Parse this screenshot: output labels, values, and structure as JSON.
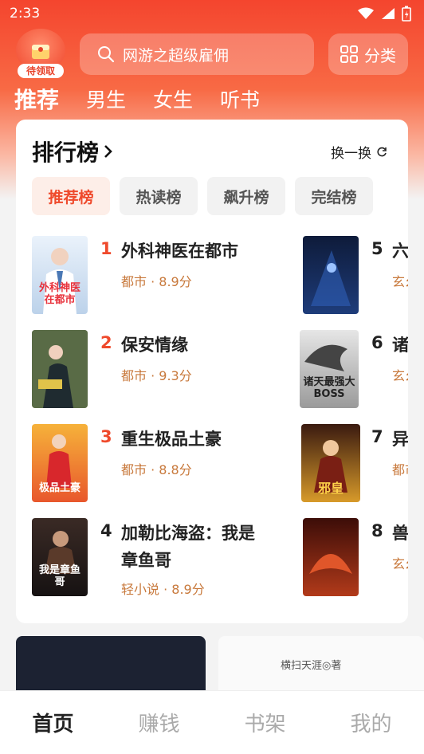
{
  "status_bar": {
    "time": "2:33"
  },
  "header": {
    "gift_badge": "待领取",
    "search_placeholder": "网游之超级雇佣",
    "category_label": "分类"
  },
  "tabs": [
    "推荐",
    "男生",
    "女生",
    "听书"
  ],
  "ranking": {
    "title": "排行榜",
    "refresh_label": "换一换",
    "rank_tabs": [
      "推荐榜",
      "热读榜",
      "飙升榜",
      "完结榜"
    ],
    "books": [
      {
        "rank": "1",
        "title": "外科神医在都市",
        "meta": "都市 · 8.9分",
        "cover_text": "外科神医在都市"
      },
      {
        "rank": "2",
        "title": "保安情缘",
        "meta": "都市 · 9.3分",
        "cover_text": ""
      },
      {
        "rank": "3",
        "title": "重生极品土豪",
        "meta": "都市 · 8.8分",
        "cover_text": "极品土豪"
      },
      {
        "rank": "4",
        "title": "加勒比海盗：我是章鱼哥",
        "meta": "轻小说 · 8.9分",
        "cover_text": "我是章鱼哥"
      },
      {
        "rank": "5",
        "title": "六",
        "meta": "玄幺",
        "cover_text": ""
      },
      {
        "rank": "6",
        "title": "诸",
        "meta": "玄幺",
        "cover_text": "诸天最强大BOSS"
      },
      {
        "rank": "7",
        "title": "异",
        "meta": "都市",
        "cover_text": "邪皇"
      },
      {
        "rank": "8",
        "title": "兽",
        "meta": "玄幺",
        "cover_text": ""
      }
    ]
  },
  "banners": {
    "second_text": "横扫天涯◎著"
  },
  "bottom_nav": [
    "首页",
    "赚钱",
    "书架",
    "我的"
  ],
  "colors": {
    "accent": "#ef4a2c",
    "meta": "#c8793c"
  }
}
